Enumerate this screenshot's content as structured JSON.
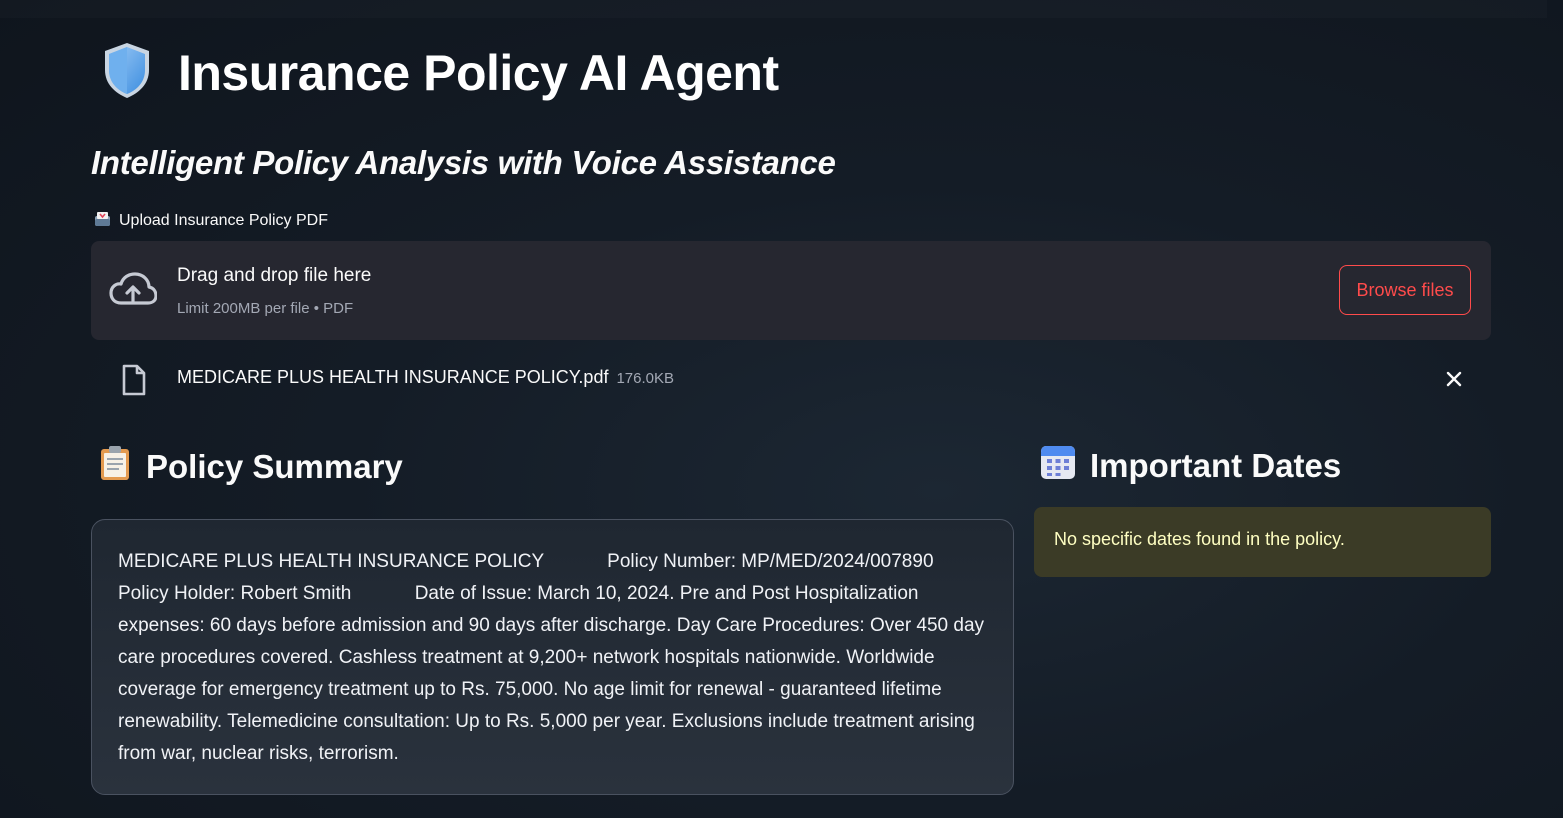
{
  "app": {
    "title": "Insurance Policy AI Agent",
    "title_icon": "shield-icon",
    "subtitle": "Intelligent Policy Analysis with Voice Assistance"
  },
  "uploader": {
    "label": "Upload Insurance Policy PDF",
    "label_icon": "inbox-tray-icon",
    "dropzone_title": "Drag and drop file here",
    "dropzone_limit": "Limit 200MB per file • PDF",
    "browse_label": "Browse files",
    "uploaded_file": {
      "name": "MEDICARE PLUS HEALTH INSURANCE POLICY.pdf",
      "size": "176.0KB"
    }
  },
  "summary": {
    "heading": "Policy Summary",
    "heading_icon": "clipboard-icon",
    "text": "MEDICARE PLUS HEALTH INSURANCE POLICY            Policy Number: MP/MED/2024/007890            Policy Holder: Robert Smith            Date of Issue: March 10, 2024. Pre and Post Hospitalization expenses: 60 days before admission and 90 days after discharge. Day Care Procedures: Over 450 day care procedures covered. Cashless treatment at 9,200+ network hospitals nationwide. Worldwide coverage for emergency treatment up to Rs. 75,000. No age limit for renewal - guaranteed lifetime renewability. Telemedicine consultation: Up to Rs. 5,000 per year. Exclusions include treatment arising from war, nuclear risks, terrorism."
  },
  "dates": {
    "heading": "Important Dates",
    "heading_icon": "calendar-icon",
    "message": "No specific dates found in the policy."
  },
  "colors": {
    "accent": "#ff4b4b",
    "background": "#141c26",
    "card": "#262730",
    "warning_bg": "#3b3b26",
    "warning_text": "#ffffc2"
  }
}
